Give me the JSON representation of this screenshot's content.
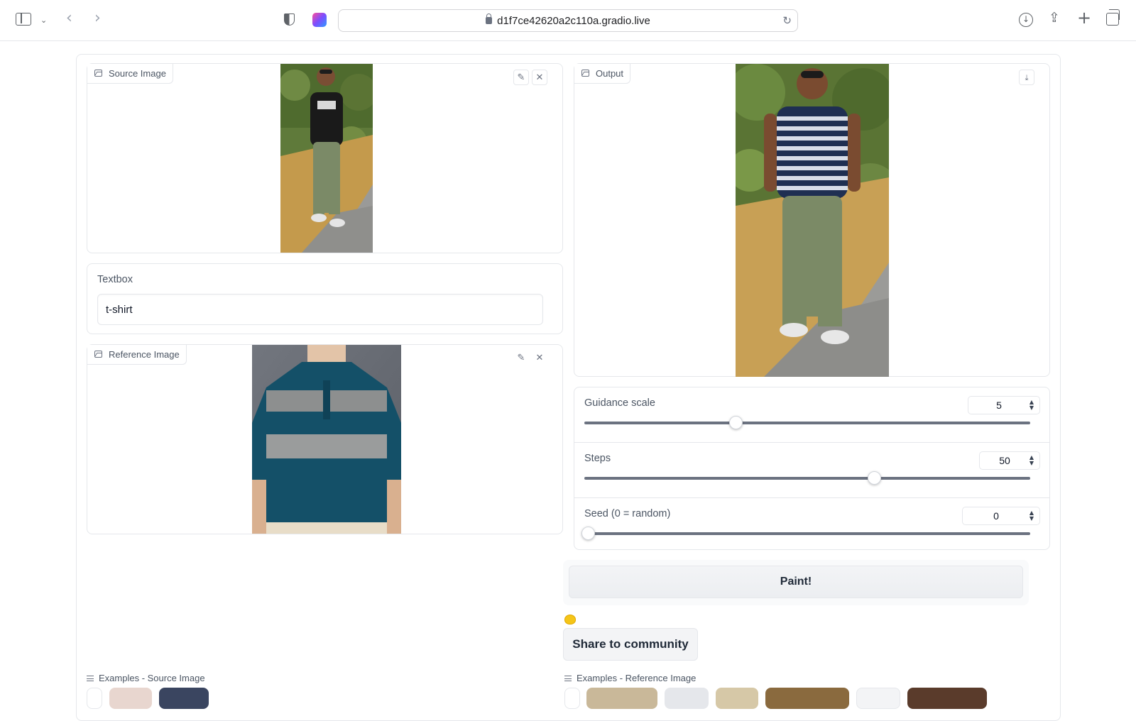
{
  "browser": {
    "url": "d1f7ce42620a2c110a.gradio.live"
  },
  "source_image": {
    "label": "Source Image"
  },
  "textbox": {
    "label": "Textbox",
    "value": "t-shirt"
  },
  "reference_image": {
    "label": "Reference Image"
  },
  "output": {
    "label": "Output"
  },
  "sliders": {
    "guidance": {
      "label": "Guidance scale",
      "value": "5",
      "fraction": 0.34
    },
    "steps": {
      "label": "Steps",
      "value": "50",
      "fraction": 0.65
    },
    "seed": {
      "label": "Seed (0 = random)",
      "value": "0",
      "fraction": 0.0
    }
  },
  "actions": {
    "paint_label": "Paint!",
    "share_label": "Share to community"
  },
  "examples": {
    "source_label": "Examples - Source Image",
    "reference_label": "Examples - Reference Image"
  },
  "icons": {
    "sidebar": "sidebar-icon",
    "back": "chevron-left-icon",
    "forward": "chevron-right-icon",
    "shield": "shield-icon",
    "lock": "lock-icon",
    "reload": "reload-icon",
    "download": "download-icon",
    "share": "share-icon",
    "new_tab": "plus-icon",
    "tabs": "tabs-icon"
  }
}
